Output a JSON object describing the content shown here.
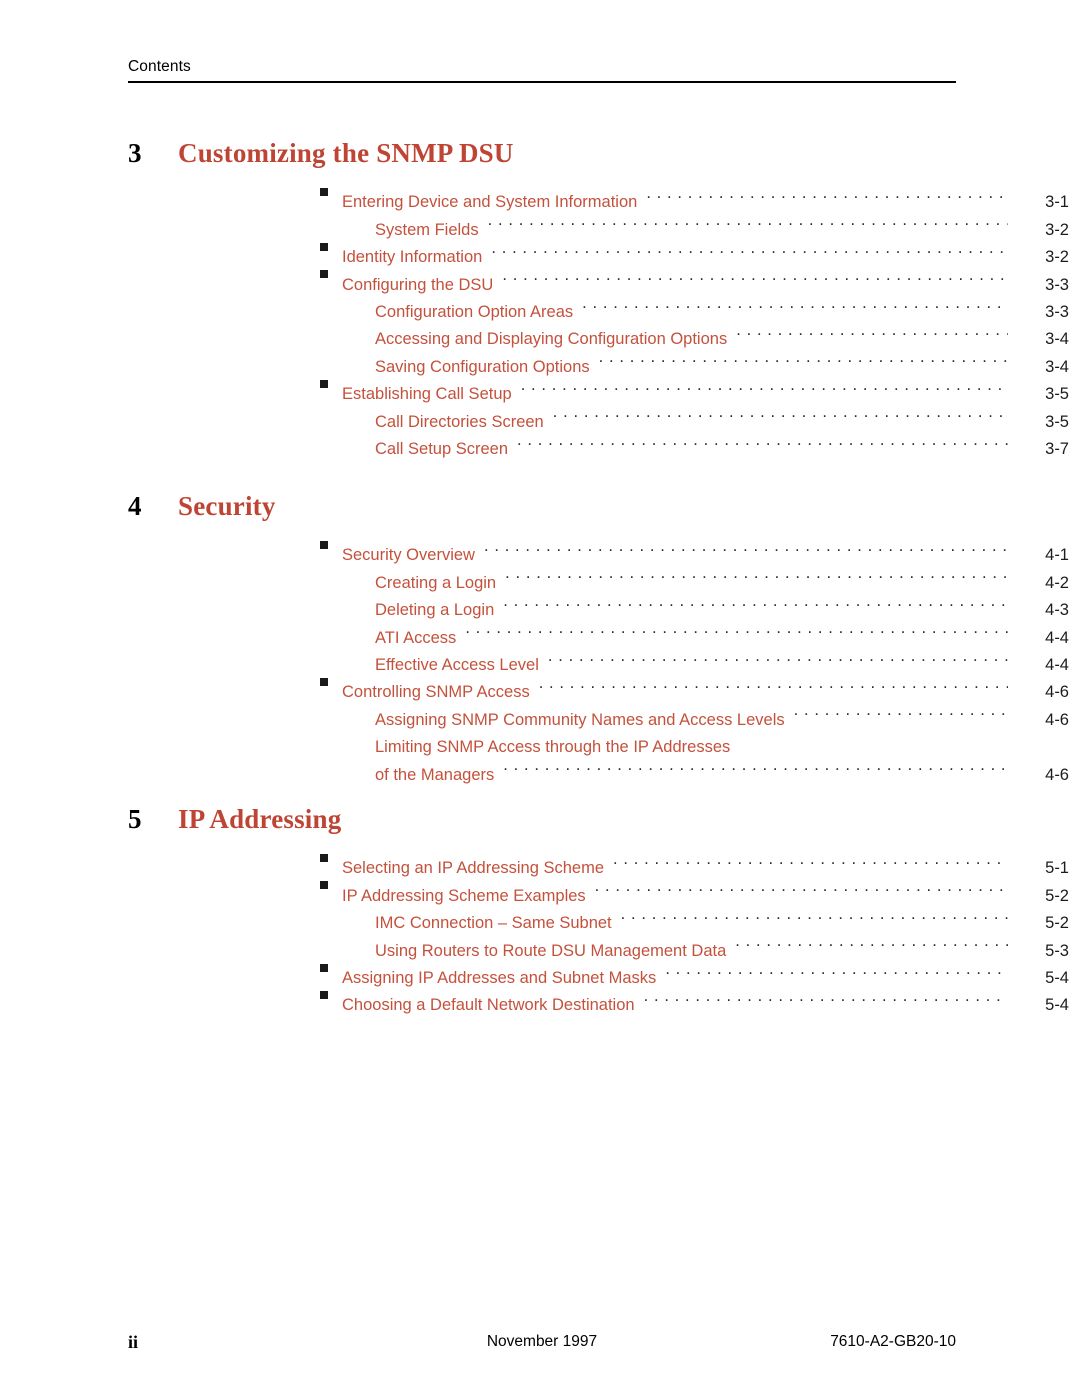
{
  "header": {
    "label": "Contents"
  },
  "colors": {
    "accent_red": "#C4513C",
    "heading_red": "#BE4433",
    "text_black": "#000000",
    "leader_gray": "#2b2b2b"
  },
  "chapters": [
    {
      "number": "3",
      "title": "Customizing the SNMP DSU",
      "entries": [
        {
          "level": 1,
          "label": "Entering Device and System Information",
          "page": "3-1"
        },
        {
          "level": 2,
          "label": "System Fields",
          "page": "3-2"
        },
        {
          "level": 1,
          "label": "Identity Information",
          "page": "3-2"
        },
        {
          "level": 1,
          "label": "Configuring the DSU",
          "page": "3-3"
        },
        {
          "level": 2,
          "label": "Configuration Option Areas",
          "page": "3-3"
        },
        {
          "level": 2,
          "label": "Accessing and Displaying Configuration Options",
          "page": "3-4"
        },
        {
          "level": 2,
          "label": "Saving Configuration Options",
          "page": "3-4"
        },
        {
          "level": 1,
          "label": "Establishing Call Setup",
          "page": "3-5"
        },
        {
          "level": 2,
          "label": "Call Directories Screen",
          "page": "3-5"
        },
        {
          "level": 2,
          "label": "Call Setup Screen",
          "page": "3-7"
        }
      ]
    },
    {
      "number": "4",
      "title": "Security",
      "entries": [
        {
          "level": 1,
          "label": "Security Overview",
          "page": "4-1"
        },
        {
          "level": 2,
          "label": "Creating a Login",
          "page": "4-2"
        },
        {
          "level": 2,
          "label": "Deleting a Login",
          "page": "4-3"
        },
        {
          "level": 2,
          "label": "ATI Access",
          "page": "4-4"
        },
        {
          "level": 2,
          "label": "Effective Access Level",
          "page": "4-4"
        },
        {
          "level": 1,
          "label": "Controlling SNMP Access",
          "page": "4-6"
        },
        {
          "level": 2,
          "label": "Assigning SNMP Community Names and Access Levels",
          "page": "4-6"
        },
        {
          "level": 2,
          "label": "Limiting SNMP Access through the IP Addresses",
          "page": "",
          "wrapped_head": true
        },
        {
          "level": 2,
          "label": "of the Managers",
          "page": "4-6"
        }
      ]
    },
    {
      "number": "5",
      "title": "IP Addressing",
      "entries": [
        {
          "level": 1,
          "label": "Selecting an IP Addressing Scheme",
          "page": "5-1"
        },
        {
          "level": 1,
          "label": "IP Addressing Scheme Examples",
          "page": "5-2"
        },
        {
          "level": 2,
          "label": "IMC Connection – Same Subnet",
          "page": "5-2"
        },
        {
          "level": 2,
          "label": "Using Routers to Route DSU Management Data",
          "page": "5-3"
        },
        {
          "level": 1,
          "label": "Assigning IP Addresses and Subnet Masks",
          "page": "5-4"
        },
        {
          "level": 1,
          "label": "Choosing a Default Network Destination",
          "page": "5-4"
        }
      ]
    }
  ],
  "footer": {
    "page_number": "ii",
    "date": "November 1997",
    "document_number": "7610-A2-GB20-10"
  }
}
